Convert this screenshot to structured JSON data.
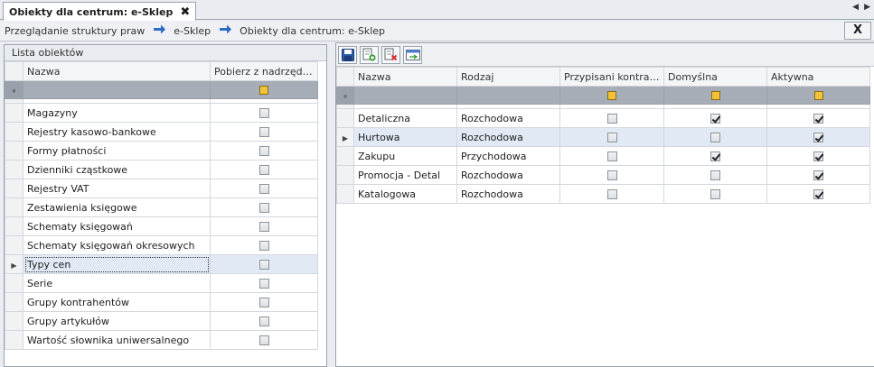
{
  "tab": {
    "title": "Obiekty dla centrum: e-Sklep",
    "close": "✖"
  },
  "tab_nav": {
    "prev": "◀",
    "next": "▶"
  },
  "breadcrumb": [
    "Przeglądanie struktury praw",
    "e-Sklep",
    "Obiekty dla centrum: e-Sklep"
  ],
  "breadcrumb_arrow": "➔",
  "close_button": "X",
  "colors": {
    "filter_row": "#a7adb6",
    "filter_checkbox": "#f2c33a",
    "selected_row": "#e1e9f5",
    "arrow": "#2b6cc4"
  },
  "left_panel": {
    "title": "Lista obiektów",
    "columns": [
      "Nazwa",
      "Pobierz z nadrzędnego"
    ],
    "filter_pin": "ᵩ",
    "rows": [
      {
        "name": "Magazyny",
        "checked": false
      },
      {
        "name": "Rejestry kasowo-bankowe",
        "checked": false
      },
      {
        "name": "Formy płatności",
        "checked": false
      },
      {
        "name": "Dzienniki cząstkowe",
        "checked": false
      },
      {
        "name": "Rejestry VAT",
        "checked": false
      },
      {
        "name": "Zestawienia księgowe",
        "checked": false
      },
      {
        "name": "Schematy księgowań",
        "checked": false
      },
      {
        "name": "Schematy księgowań okresowych",
        "checked": false
      },
      {
        "name": "Typy cen",
        "checked": false,
        "selected": true
      },
      {
        "name": "Serie",
        "checked": false
      },
      {
        "name": "Grupy kontrahentów",
        "checked": false
      },
      {
        "name": "Grupy artykułów",
        "checked": false
      },
      {
        "name": "Wartość słownika uniwersalnego",
        "checked": false
      }
    ]
  },
  "right_panel": {
    "toolbar_icons": [
      "save-icon",
      "add-row-icon",
      "delete-row-icon",
      "edit-row-icon"
    ],
    "columns": [
      "Nazwa",
      "Rodzaj",
      "Przypisani kontrahenci",
      "Domyślna",
      "Aktywna"
    ],
    "rows": [
      {
        "name": "Detaliczna",
        "type": "Rozchodowa",
        "assigned": false,
        "default": true,
        "active": true
      },
      {
        "name": "Hurtowa",
        "type": "Rozchodowa",
        "assigned": false,
        "default": false,
        "active": true,
        "selected": true
      },
      {
        "name": "Zakupu",
        "type": "Przychodowa",
        "assigned": false,
        "default": true,
        "active": true
      },
      {
        "name": "Promocja - Detal",
        "type": "Rozchodowa",
        "assigned": false,
        "default": false,
        "active": true
      },
      {
        "name": "Katalogowa",
        "type": "Rozchodowa",
        "assigned": false,
        "default": false,
        "active": true
      }
    ]
  },
  "row_indicator": "▶"
}
